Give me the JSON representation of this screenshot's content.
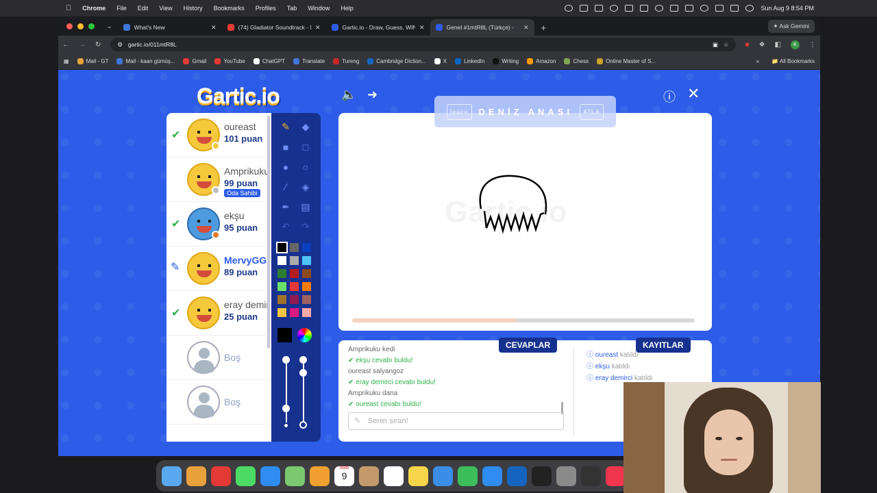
{
  "menubar": {
    "app": "Chrome",
    "items": [
      "File",
      "Edit",
      "View",
      "History",
      "Bookmarks",
      "Profiles",
      "Tab",
      "Window",
      "Help"
    ],
    "clock": "Sun Aug 9  8:54 PM"
  },
  "tabs": [
    {
      "title": "What's New",
      "color": "#3c78d8"
    },
    {
      "title": "(74) Gladiator Soundtrack - N",
      "color": "#e53935"
    },
    {
      "title": "Gartic.io - Draw, Guess, WIN",
      "color": "#2c5ce8"
    },
    {
      "title": "Genel #1mtR8L (Türkçe) -",
      "color": "#2c5ce8"
    }
  ],
  "ask_gemini": "Ask Gemini",
  "address": {
    "url": "gartic.io/011mtR8L",
    "profile_letter": "K"
  },
  "bookmarks": [
    {
      "label": "Mail - GT",
      "color": "#e8a33a"
    },
    {
      "label": "Mail - kaan gümüş...",
      "color": "#3c78d8"
    },
    {
      "label": "Gmail",
      "color": "#e53935"
    },
    {
      "label": "YouTube",
      "color": "#e53935"
    },
    {
      "label": "ChatGPT",
      "color": "#ffffff"
    },
    {
      "label": "Translate",
      "color": "#3c78d8"
    },
    {
      "label": "Tureng",
      "color": "#c62828"
    },
    {
      "label": "Cambridge Diction...",
      "color": "#1565c0"
    },
    {
      "label": "X",
      "color": "#ffffff"
    },
    {
      "label": "LinkedIn",
      "color": "#0a66c2"
    },
    {
      "label": "Writing",
      "color": "#111111"
    },
    {
      "label": "Amazon",
      "color": "#ff9900"
    },
    {
      "label": "Chess",
      "color": "#7fa650"
    },
    {
      "label": "Online Master of S...",
      "color": "#c9a227"
    }
  ],
  "all_bookmarks": "All Bookmarks",
  "game": {
    "logo": "Gartic.io",
    "hint_left": "İpucu",
    "hint_word": "DENİZ ANASI",
    "hint_right": "ATLA",
    "watermark": "Gartic.io",
    "progress": 0.48,
    "players": [
      {
        "name": "oureast",
        "score": "101 puan",
        "status": "guessed",
        "dot": "#f6c83c"
      },
      {
        "name": "Amprikuku",
        "score": "99 puan",
        "status": "owner",
        "badge": "Oda Sahibi",
        "dot": "#bdbdbd"
      },
      {
        "name": "ekşu",
        "score": "95 puan",
        "status": "guessed",
        "dot": "#e07a2a"
      },
      {
        "name": "MervyGG",
        "score": "89 puan",
        "status": "drawing",
        "dot": ""
      },
      {
        "name": "eray demirci",
        "score": "25 puan",
        "status": "guessed",
        "dot": ""
      },
      {
        "name": "Boş",
        "score": "",
        "status": "empty",
        "dot": ""
      },
      {
        "name": "Boş",
        "score": "",
        "status": "empty",
        "dot": ""
      }
    ],
    "answers_tab": "CEVAPLAR",
    "logs_tab": "KAYITLAR",
    "answers": [
      {
        "user": "Amprikuku",
        "text": "kedi",
        "ok": false
      },
      {
        "user": "ekşu",
        "text": "cevabı buldu!",
        "ok": true
      },
      {
        "user": "oureast",
        "text": "salyangoz",
        "ok": false
      },
      {
        "user": "eray demirci",
        "text": "cevabı buldu!",
        "ok": true
      },
      {
        "user": "Amprikuku",
        "text": "dana",
        "ok": false
      },
      {
        "user": "oureast",
        "text": "cevabı buldu!",
        "ok": true
      }
    ],
    "answer_placeholder": "Senin sıran!",
    "logs": [
      {
        "user": "oureast",
        "text": "katıldı"
      },
      {
        "user": "ekşu",
        "text": "katıldı"
      },
      {
        "user": "eray demirci",
        "text": "katıldı"
      }
    ],
    "colors": [
      "#000000",
      "#666666",
      "#0a3fbf",
      "#ffffff",
      "#aaaaaa",
      "#4fc3f7",
      "#2e7d32",
      "#b71c1c",
      "#8d4a1a",
      "#69e16b",
      "#e53935",
      "#f57c00",
      "#a0722a",
      "#8e1a4e",
      "#a06060",
      "#f4c542",
      "#d81b80",
      "#f7a8a8"
    ]
  },
  "dock_apps": [
    {
      "name": "Finder",
      "color": "#5aa9f0"
    },
    {
      "name": "Launchpad",
      "color": "#e9a23b"
    },
    {
      "name": "Opera",
      "color": "#e53935"
    },
    {
      "name": "Messages",
      "color": "#4cd964"
    },
    {
      "name": "Safari",
      "color": "#2f8cf0"
    },
    {
      "name": "Maps",
      "color": "#7bc96f"
    },
    {
      "name": "Photos",
      "color": "#f0a030"
    },
    {
      "name": "Calendar",
      "color": "#ffffff"
    },
    {
      "name": "Contacts",
      "color": "#c49a6c"
    },
    {
      "name": "Reminders",
      "color": "#ffffff"
    },
    {
      "name": "Notes",
      "color": "#f7d54a"
    },
    {
      "name": "Keynote",
      "color": "#3a8ee6"
    },
    {
      "name": "Numbers",
      "color": "#3cbf5a"
    },
    {
      "name": "App Store",
      "color": "#2f8cf0"
    },
    {
      "name": "Outlook",
      "color": "#1565c0"
    },
    {
      "name": "Terminal",
      "color": "#222222"
    },
    {
      "name": "System Settings",
      "color": "#8a8a8a"
    },
    {
      "name": "OBS",
      "color": "#333333"
    },
    {
      "name": "Music",
      "color": "#f0364d"
    }
  ],
  "calendar_date": {
    "month": "AUG",
    "day": "9"
  },
  "status_icons": [
    "record-icon",
    "chrome-icon",
    "grid-icon",
    "cloud-icon",
    "blocked-icon",
    "screen-icon",
    "control-icon",
    "airplay-icon",
    "play-icon",
    "battery-icon",
    "wifi-icon",
    "search-icon",
    "siri-icon"
  ]
}
